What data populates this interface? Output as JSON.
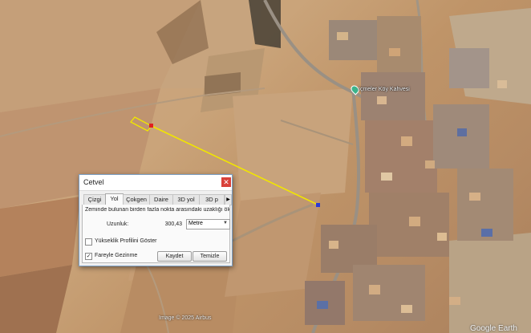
{
  "map": {
    "place_label": "İçmeler Köy Kahvesi",
    "pin_icon": "map-pin-icon",
    "attribution": "Image © 2025 Airbus",
    "watermark": "Google Earth",
    "measure_line_color": "#f1e600",
    "start_point_color": "#e02020",
    "end_point_color": "#2a3bd6"
  },
  "dialog": {
    "title": "Cetvel",
    "close_symbol": "✕",
    "tabs": [
      "Çizgi",
      "Yol",
      "Çokgen",
      "Daire",
      "3D yol",
      "3D p"
    ],
    "active_tab": "Yol",
    "more_tabs_symbol": "▶",
    "description": "Zeminde bulunan birden fazla nokta arasındaki uzaklığı ölç",
    "length_label": "Uzunluk:",
    "length_value": "300,43",
    "unit_value": "Metre",
    "unit_arrow": "▼",
    "elevation_profile_label": "Yükseklik Profilini Göster",
    "elevation_profile_checked": "",
    "mouse_nav_label": "Fareyle Gezinme",
    "mouse_nav_checked": "✓",
    "save_label": "Kaydet",
    "clear_label": "Temizle"
  }
}
